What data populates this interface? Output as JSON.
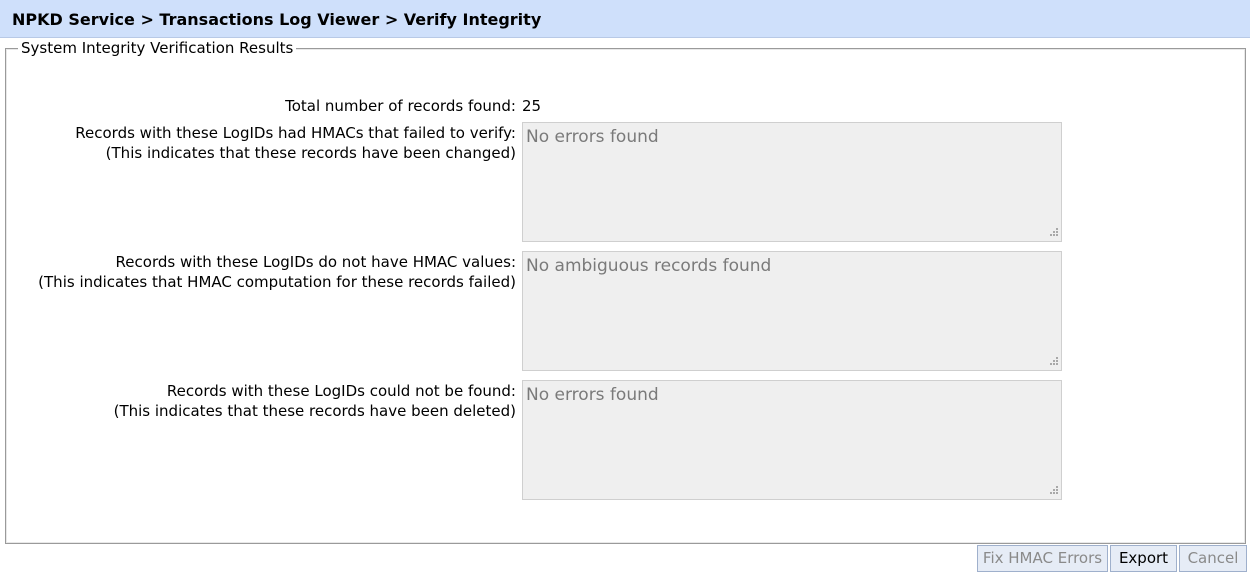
{
  "header": {
    "breadcrumb": "NPKD Service > Transactions Log Viewer > Verify Integrity"
  },
  "panel": {
    "legend": "System Integrity Verification Results",
    "total": {
      "label": "Total number of records found:",
      "value": "25"
    },
    "failed_hmac": {
      "label_line1": "Records with these LogIDs had HMACs that failed to verify:",
      "label_line2": "(This indicates that these records have been changed)",
      "text": "No errors found"
    },
    "missing_hmac": {
      "label_line1": "Records with these LogIDs do not have HMAC values:",
      "label_line2": "(This indicates that HMAC computation for these records failed)",
      "text": "No ambiguous records found"
    },
    "not_found": {
      "label_line1": "Records with these LogIDs could not be found:",
      "label_line2": "(This indicates that these records have been deleted)",
      "text": "No errors found"
    }
  },
  "buttons": {
    "fix_hmac": "Fix HMAC Errors",
    "export": "Export",
    "cancel": "Cancel"
  },
  "colors": {
    "header_bg": "#cfe0fb",
    "textarea_bg": "#efefef",
    "button_bg": "#e6ecf6"
  }
}
